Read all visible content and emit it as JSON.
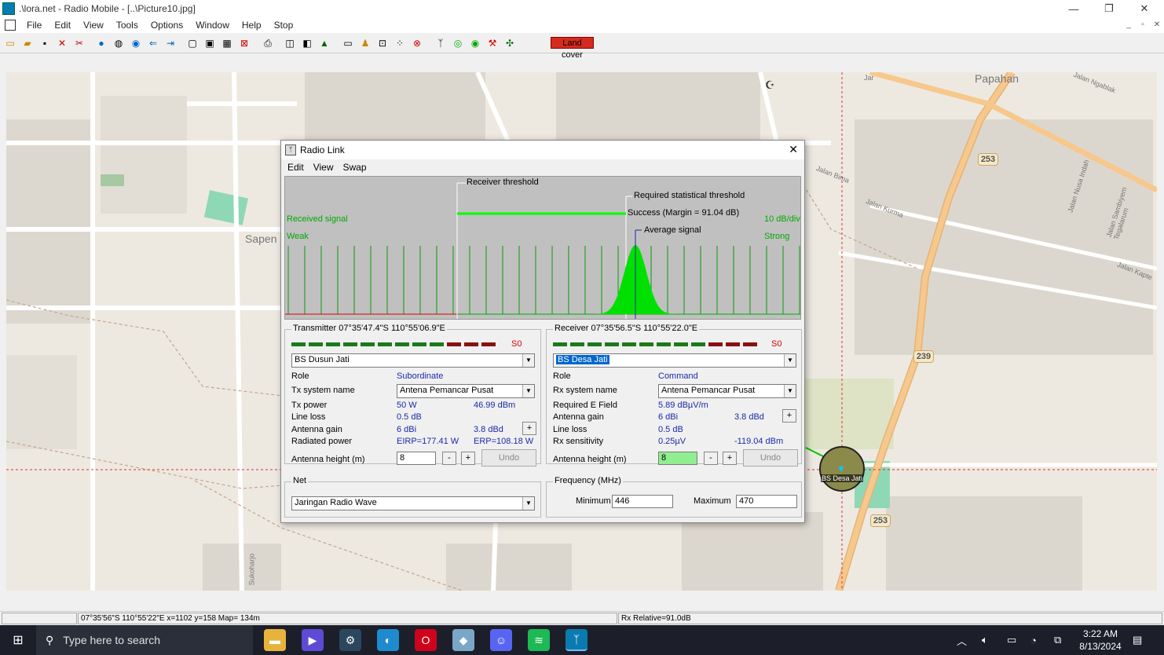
{
  "window": {
    "title": ".\\lora.net - Radio Mobile - [..\\Picture10.jpg]",
    "minimize": "—",
    "restore": "❐",
    "close": "✕"
  },
  "menu": [
    "File",
    "Edit",
    "View",
    "Tools",
    "Options",
    "Window",
    "Help",
    "Stop"
  ],
  "toolbar": {
    "land_cover": "Land cover"
  },
  "map": {
    "labels": {
      "papahan": "Papahan",
      "sapen": "Sapen",
      "jalan_ngablak": "Jalan Ngablak",
      "jalan_bima": "Jalan Bima",
      "jalan_kurma": "Jalan Kurma",
      "jalan_nusa_indah": "Jalan Nusa Indah",
      "jalan_kapte": "Jalan Kapte",
      "jalan_sambiyem": "Jalan Sambiyem Tegalarum",
      "sukoharjo": "Sukoharjo",
      "jar": "Jar"
    },
    "shields": [
      "253",
      "239",
      "253"
    ],
    "station_label": "BS Desa Jati"
  },
  "dialog": {
    "title": "Radio Link",
    "menu": [
      "Edit",
      "View",
      "Swap"
    ],
    "graph": {
      "receiver_threshold": "Receiver threshold",
      "required_statistical_threshold": "Required statistical threshold",
      "success": "Success (Margin = 91.04 dB)",
      "average_signal": "Average signal",
      "received_signal": "Received signal",
      "weak": "Weak",
      "strong": "Strong",
      "scale": "10 dB/div"
    },
    "transmitter": {
      "title": "Transmitter 07°35'47.4\"S 110°55'06.9\"E",
      "s_value": "S0",
      "unit": "BS Dusun Jati",
      "role_label": "Role",
      "role_value": "Subordinate",
      "system_label": "Tx system name",
      "system_value": "Antena Pemancar Pusat",
      "power_label": "Tx power",
      "power_w": "50 W",
      "power_dbm": "46.99 dBm",
      "line_loss_label": "Line loss",
      "line_loss": "0.5 dB",
      "antenna_gain_label": "Antenna gain",
      "antenna_gain_dbi": "6 dBi",
      "antenna_gain_dbd": "3.8 dBd",
      "radiated_label": "Radiated power",
      "eirp": "EIRP=177.41 W",
      "erp": "ERP=108.18 W",
      "height_label": "Antenna height (m)",
      "height_value": "8",
      "undo": "Undo"
    },
    "receiver": {
      "title": "Receiver 07°35'56.5\"S 110°55'22.0\"E",
      "s_value": "S0",
      "unit": "BS Desa Jati",
      "role_label": "Role",
      "role_value": "Command",
      "system_label": "Rx system name",
      "system_value": "Antena Pemancar Pusat",
      "efield_label": "Required E Field",
      "efield_value": "5.89 dBµV/m",
      "antenna_gain_label": "Antenna gain",
      "antenna_gain_dbi": "6 dBi",
      "antenna_gain_dbd": "3.8 dBd",
      "line_loss_label": "Line loss",
      "line_loss": "0.5 dB",
      "sens_label": "Rx sensitivity",
      "sens_uv": "0.25µV",
      "sens_dbm": "-119.04 dBm",
      "height_label": "Antenna height (m)",
      "height_value": "8",
      "undo": "Undo"
    },
    "net": {
      "title": "Net",
      "value": "Jaringan Radio Wave"
    },
    "frequency": {
      "title": "Frequency (MHz)",
      "min_label": "Minimum",
      "min_value": "446",
      "max_label": "Maximum",
      "max_value": "470"
    }
  },
  "statusbar": {
    "coords": "07°35'56\"S  110°55'22\"E   x=1102 y=158 Map= 134m",
    "rx": "Rx Relative=91.0dB"
  },
  "taskbar": {
    "search_placeholder": "Type here to search",
    "time": "3:22 AM",
    "date": "8/13/2024"
  }
}
